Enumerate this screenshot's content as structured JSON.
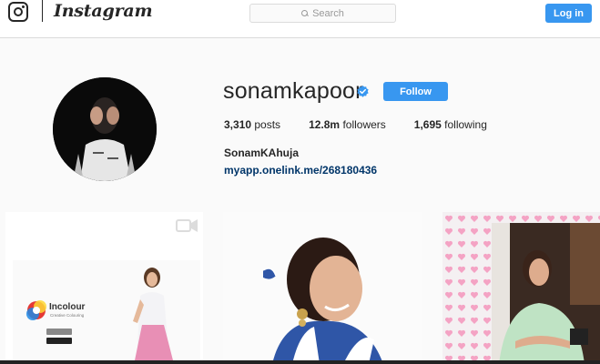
{
  "header": {
    "logo_text": "Instagram",
    "search_placeholder": "Search",
    "login_label": "Log in"
  },
  "profile": {
    "username": "sonamkapoor",
    "verified": true,
    "follow_label": "Follow",
    "stats": {
      "posts_count": "3,310",
      "posts_label": "posts",
      "followers_count": "12.8m",
      "followers_label": "followers",
      "following_count": "1,695",
      "following_label": "following"
    },
    "full_name": "SonamKAhuja",
    "link": "myapp.onelink.me/268180436"
  },
  "posts": [
    {
      "type": "video",
      "text_brand": "Incolour",
      "text_tagline": "Creative Colouring"
    },
    {
      "type": "photo"
    },
    {
      "type": "photo"
    }
  ],
  "colors": {
    "accent": "#3897f0",
    "link": "#003569",
    "background": "#fafafa",
    "text": "#262626"
  },
  "icons": [
    "instagram-glyph-icon",
    "search-icon",
    "verified-badge-icon",
    "video-icon"
  ]
}
